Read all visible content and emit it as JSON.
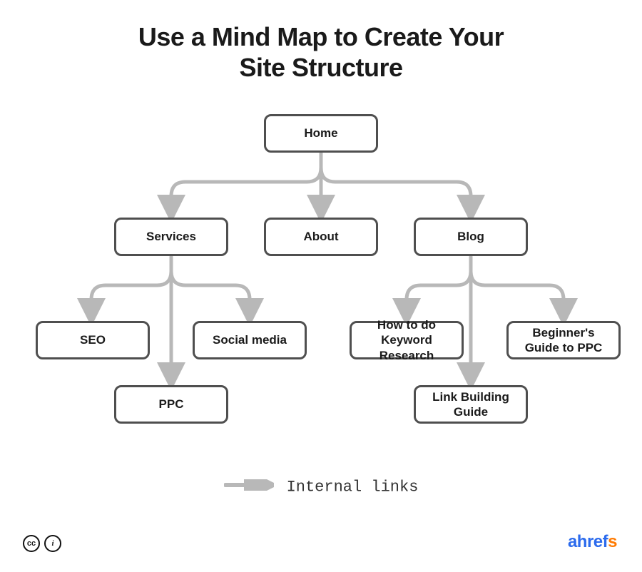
{
  "title_line1": "Use a Mind Map to Create Your",
  "title_line2": "Site Structure",
  "nodes": {
    "home": "Home",
    "services": "Services",
    "about": "About",
    "blog": "Blog",
    "seo": "SEO",
    "social": "Social media",
    "ppc": "PPC",
    "kw": "How to do Keyword Research",
    "bg_ppc": "Beginner's Guide to PPC",
    "link_build": "Link Building Guide"
  },
  "legend": {
    "label": "Internal links"
  },
  "brand": {
    "a": "ahrefs"
  },
  "license": {
    "cc": "cc",
    "by": "i"
  },
  "colors": {
    "node_border": "#4f4f4f",
    "arrow": "#b8b8b8",
    "brand_blue": "#2c6bed",
    "brand_orange": "#ff7a00"
  }
}
